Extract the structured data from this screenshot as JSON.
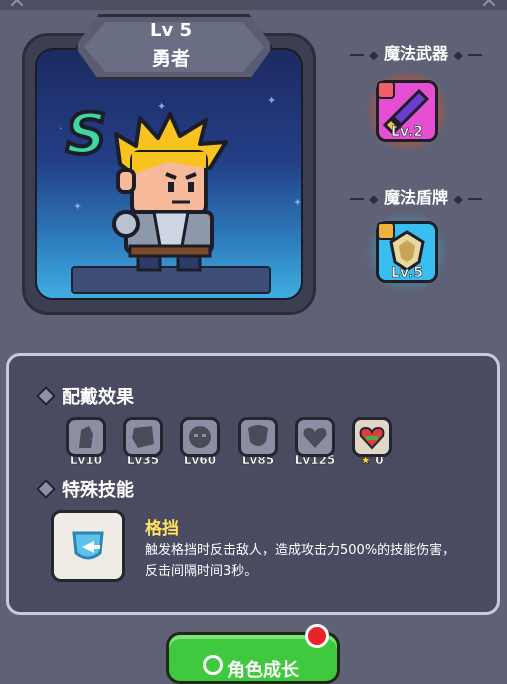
{
  "hero": {
    "level": "Lv 5",
    "name": "勇者",
    "rank": "S"
  },
  "equipment": [
    {
      "label": "魔法武器",
      "level": "Lv.2",
      "icon": "magic-sword-icon",
      "accent": "#e64fd4"
    },
    {
      "label": "魔法盾牌",
      "level": "Lv.5",
      "icon": "magic-shield-icon",
      "accent": "#38bff0"
    }
  ],
  "wear_effects": {
    "title": "配戴效果",
    "items": [
      {
        "label": "Lv10",
        "icon": "shadow-figure-icon"
      },
      {
        "label": "Lv35",
        "icon": "shield-crest-icon"
      },
      {
        "label": "Lv60",
        "icon": "demon-face-icon"
      },
      {
        "label": "Lv85",
        "icon": "shield-icon"
      },
      {
        "label": "Lv125",
        "icon": "heart-icon"
      },
      {
        "label": "0",
        "icon": "heart-gem-icon",
        "prefix_icon": "star-icon"
      }
    ]
  },
  "special_skill": {
    "title": "特殊技能",
    "name": "格挡",
    "description": "触发格挡时反击敌人，造成攻击力500%的技能伤害，反击间隔时间3秒。",
    "icon": "block-shield-icon"
  },
  "grow_button": {
    "label": "角色成长"
  }
}
